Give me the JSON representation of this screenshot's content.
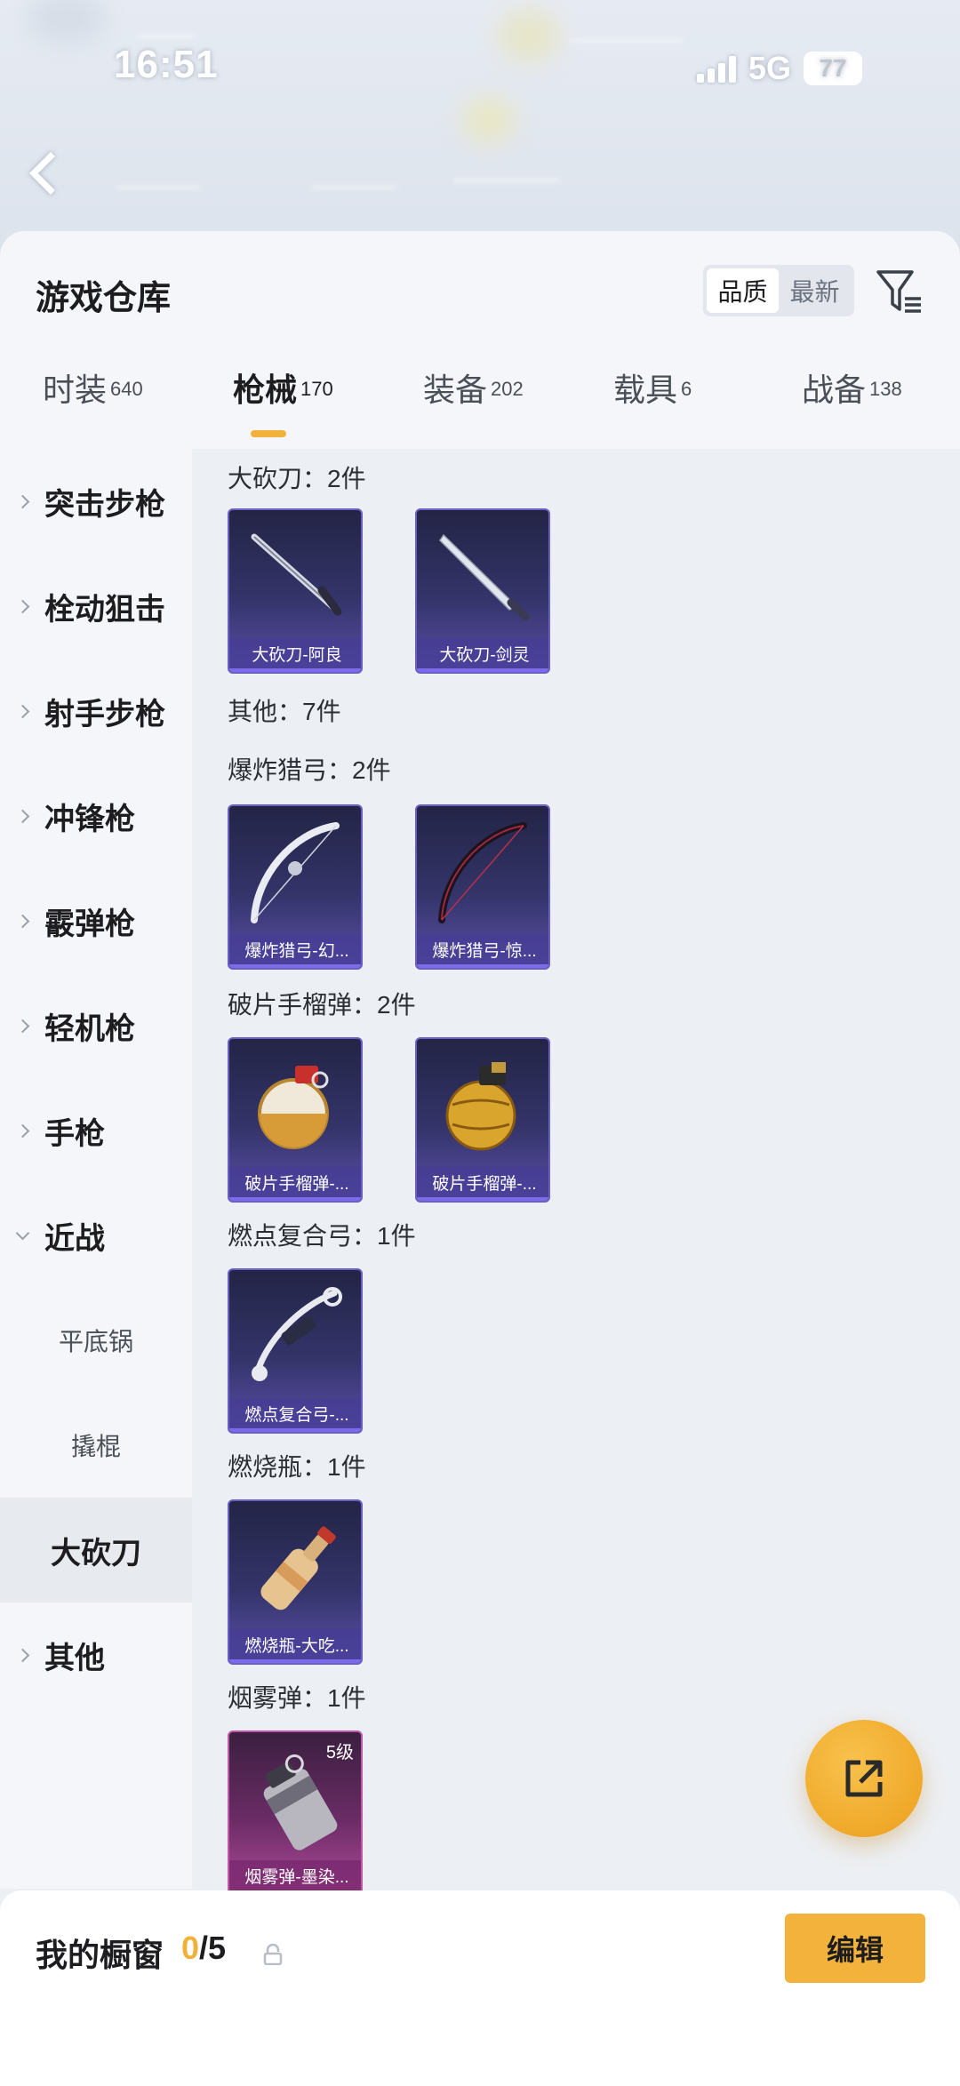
{
  "status_bar": {
    "time": "16:51",
    "network": "5G",
    "battery": "77"
  },
  "warehouse": {
    "title": "游戏仓库",
    "sort": {
      "options": [
        "品质",
        "最新"
      ],
      "selected": "品质"
    },
    "filter_icon": "filter-icon"
  },
  "tabs": [
    {
      "label": "时装",
      "count": "640",
      "active": false
    },
    {
      "label": "枪械",
      "count": "170",
      "active": true
    },
    {
      "label": "装备",
      "count": "202",
      "active": false
    },
    {
      "label": "载具",
      "count": "6",
      "active": false
    },
    {
      "label": "战备",
      "count": "138",
      "active": false
    }
  ],
  "sidebar": {
    "items": [
      {
        "label": "突击步枪"
      },
      {
        "label": "栓动狙击"
      },
      {
        "label": "射手步枪"
      },
      {
        "label": "冲锋枪"
      },
      {
        "label": "霰弹枪"
      },
      {
        "label": "轻机枪"
      },
      {
        "label": "手枪"
      },
      {
        "label": "近战"
      },
      {
        "label": "平底锅"
      },
      {
        "label": "撬棍"
      },
      {
        "label": "大砍刀"
      },
      {
        "label": "其他"
      }
    ],
    "selected": "大砍刀"
  },
  "content": {
    "groups": [
      {
        "title": "大砍刀：2件",
        "cards": [
          "大砍刀-阿良",
          "大砍刀-剑灵"
        ]
      },
      {
        "title": "其他：7件",
        "cards": []
      },
      {
        "title": "爆炸猎弓：2件",
        "cards": [
          "爆炸猎弓-幻...",
          "爆炸猎弓-惊..."
        ]
      },
      {
        "title": "破片手榴弹：2件",
        "cards": [
          "破片手榴弹-...",
          "破片手榴弹-..."
        ]
      },
      {
        "title": "燃点复合弓：1件",
        "cards": [
          "燃点复合弓-..."
        ]
      },
      {
        "title": "燃烧瓶：1件",
        "cards": [
          "燃烧瓶-大吃..."
        ]
      },
      {
        "title": "烟雾弹：1件",
        "cards": [
          "烟雾弹-墨染..."
        ],
        "level": "5级"
      }
    ]
  },
  "showcase": {
    "label": "我的橱窗",
    "current": "0",
    "separator_total": "/5",
    "edit_label": "编辑"
  }
}
